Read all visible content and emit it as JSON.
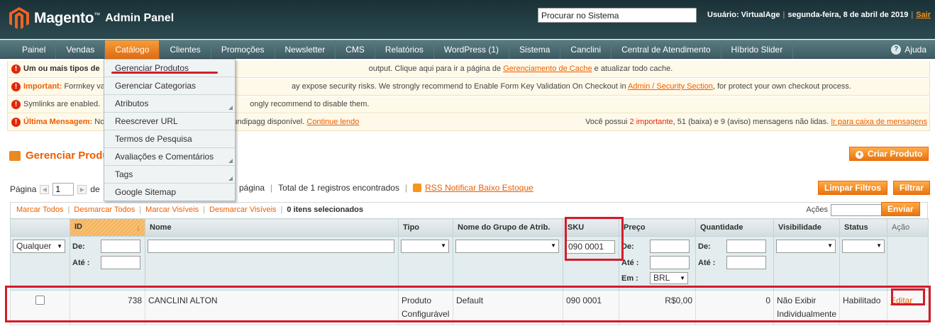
{
  "header": {
    "logo_text": "Magento",
    "logo_sub": "Admin Panel",
    "search_value": "Procurar no Sistema",
    "user_label": "Usuário: VirtualAge",
    "date": "segunda-feira, 8 de abril de 2019",
    "logout": "Sair"
  },
  "nav": {
    "items": [
      "Painel",
      "Vendas",
      "Catálogo",
      "Clientes",
      "Promoções",
      "Newsletter",
      "CMS",
      "Relatórios",
      "WordPress (1)",
      "Sistema",
      "Canclini",
      "Central de Atendimento",
      "Híbrido Slider"
    ],
    "help": "Ajuda"
  },
  "dropdown": {
    "items": [
      "Gerenciar Produtos",
      "Gerenciar Categorias",
      "Atributos",
      "Reescrever URL",
      "Termos de Pesquisa",
      "Avaliações e Comentários",
      "Tags",
      "Google Sitemap"
    ]
  },
  "messages": {
    "m1_bold": "Um ou mais tipos de",
    "m1_text": "output. Clique aqui para ir a página de",
    "m1_link": "Gerenciamento de Cache",
    "m1_tail": "e atualizar todo cache.",
    "m2_bold": "Important:",
    "m2_text": "Formkey va",
    "m2_text2": "ay expose security risks. We strongly recommend to Enable Form Key Validation On Checkout in",
    "m2_link": "Admin / Security Section",
    "m2_tail": ", for protect your own checkout process.",
    "m3_text": "Symlinks are enabled.",
    "m3_text2": "ongly recommend to disable them.",
    "m4_bold": "Última Mensagem:",
    "m4_text": "No",
    "m4_text2": "undipagg disponível.",
    "m4_link": "Continue lendo",
    "m4_right_pre": "Você possui",
    "m4_right_imp": "2 importante",
    "m4_right_mid": ", 51 (baixa) e 9 (aviso) mensagens não lidas.",
    "m4_right_link": "Ir para caixa de mensagens"
  },
  "page": {
    "title": "Gerenciar Produ",
    "create_button": "Criar Produto",
    "pager_label": "Página",
    "pager_value": "1",
    "pager_de": "de",
    "pager_per_page": "página",
    "total": "Total de 1 registros encontrados",
    "rss": "RSS Notificar Baixo Estoque",
    "reset_filter": "Limpar Filtros",
    "search_button": "Filtrar"
  },
  "massaction": {
    "select_all": "Marcar Todos",
    "unselect_all": "Desmarcar Todos",
    "select_visible": "Marcar Visíveis",
    "unselect_visible": "Desmarcar Visíveis",
    "selected_count": "0 itens selecionados",
    "actions_label": "Ações",
    "submit": "Enviar"
  },
  "grid": {
    "headers": [
      "",
      "ID",
      "Nome",
      "Tipo",
      "Nome do Grupo de Atrib.",
      "SKU",
      "Preço",
      "Quantidade",
      "Visibilidade",
      "Status",
      "Ação"
    ],
    "filter": {
      "any": "Qualquer",
      "from": "De:",
      "to": "Até :",
      "in": "Em :",
      "sku_value": "090 0001",
      "currency": "BRL"
    },
    "row": {
      "id": "738",
      "name": "CANCLINI ALTON",
      "type": "Produto Configurável",
      "attr_set": "Default",
      "sku": "090 0001",
      "price": "R$0,00",
      "qty": "0",
      "visibility": "Não Exibir Individualmente",
      "status": "Habilitado",
      "action": "Editar"
    }
  },
  "colors": {
    "accent": "#eb5e00",
    "annotation": "#d41c2a"
  }
}
